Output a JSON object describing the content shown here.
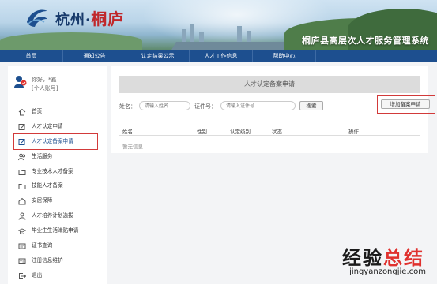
{
  "brand": {
    "logo_text_a": "杭州·",
    "logo_text_b": "桐庐",
    "site_title": "桐庐县高层次人才服务管理系统"
  },
  "nav": {
    "items": [
      {
        "label": "首页"
      },
      {
        "label": "通知公告"
      },
      {
        "label": "认定结果公示"
      },
      {
        "label": "人才工作信息"
      },
      {
        "label": "帮助中心"
      }
    ]
  },
  "user": {
    "greeting": "你好，*鑫",
    "profile_link": "[个人账号]"
  },
  "sidebar": {
    "items": [
      {
        "label": "首页",
        "icon": "home-icon"
      },
      {
        "label": "人才认定申请",
        "icon": "edit-icon"
      },
      {
        "label": "人才认定备案申请",
        "icon": "edit-icon"
      },
      {
        "label": "生活服务",
        "icon": "people-icon"
      },
      {
        "label": "专业技术人才备案",
        "icon": "folder-icon"
      },
      {
        "label": "技能人才备案",
        "icon": "folder-icon"
      },
      {
        "label": "安居保障",
        "icon": "house-icon"
      },
      {
        "label": "人才培养计划选拔",
        "icon": "user-icon"
      },
      {
        "label": "毕业生生活津贴申请",
        "icon": "cap-icon"
      },
      {
        "label": "证书查询",
        "icon": "certificate-icon"
      },
      {
        "label": "注册信息维护",
        "icon": "id-card-icon"
      },
      {
        "label": "退出",
        "icon": "logout-icon"
      }
    ],
    "active_index": 2
  },
  "main": {
    "page_title": "人才认定备案申请",
    "search": {
      "name_label": "姓名：",
      "name_placeholder": "请输入姓名",
      "id_label": "证件号：",
      "id_placeholder": "请输入证件号",
      "search_button": "搜索"
    },
    "add_button": "增加备案申请",
    "table": {
      "columns": [
        "姓名",
        "性别",
        "认定级别",
        "状态",
        "操作"
      ]
    },
    "empty_text": "暂无信息"
  },
  "watermark": {
    "text_a": "经验",
    "text_b": "总结",
    "url": "jingyanzongjie.com"
  },
  "colors": {
    "nav_bg": "#1d4f8f",
    "highlight": "#d23a3a",
    "page_bg": "#f3f4f6"
  }
}
